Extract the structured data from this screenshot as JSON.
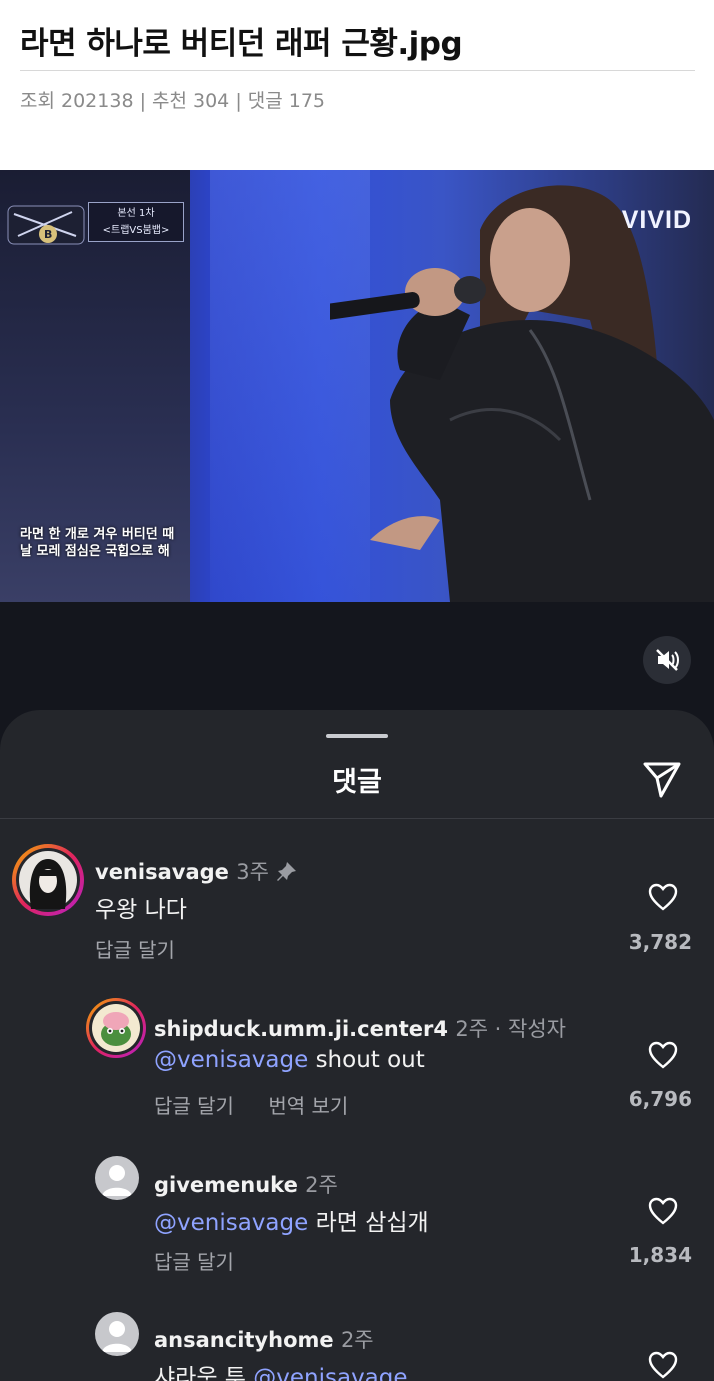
{
  "post": {
    "title": "라면 하나로 버티던 래퍼 근황.jpg",
    "meta": "조회 202138 | 추천 304 | 댓글 175"
  },
  "video": {
    "watermark": "VIVID",
    "round_line1": "본선 1차",
    "round_line2": "<트랩VS붐뱁>",
    "lyric_line1": "라면 한 개로 겨우 버티던 때",
    "lyric_line2": "날 모레 점심은 국힙으로 해",
    "mute_icon": "speaker-muted-icon"
  },
  "sheet": {
    "title": "댓글",
    "send_icon": "send-icon"
  },
  "comments": [
    {
      "username": "venisavage",
      "age": "3주",
      "text": "우왕 나다",
      "reply_label": "답글 달기",
      "likes": "3,782",
      "pinned": true
    },
    {
      "username": "shipduck.umm.ji.center4",
      "age": "2주 · 작성자",
      "mention": "@venisavage",
      "text": " shout out",
      "reply_label": "답글 달기",
      "translate_label": "번역 보기",
      "likes": "6,796"
    },
    {
      "username": "givemenuke",
      "age": "2주",
      "mention": "@venisavage",
      "text": " 라면 삼십개",
      "reply_label": "답글 달기",
      "likes": "1,834"
    },
    {
      "username": "ansancityhome",
      "age": "2주",
      "text": "샤라웃 투 ",
      "mention": "@venisavage"
    }
  ]
}
